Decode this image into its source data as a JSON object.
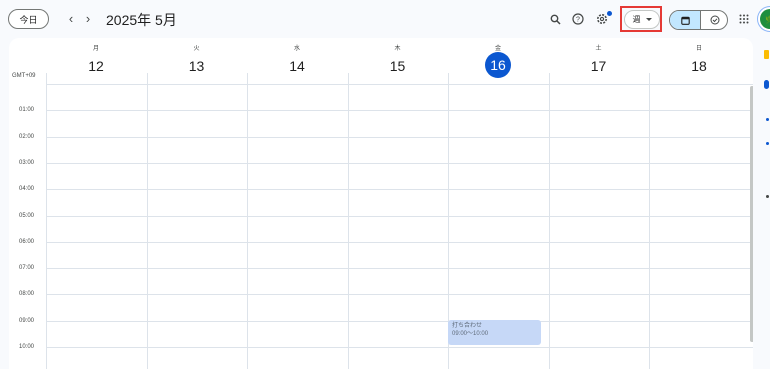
{
  "header": {
    "today_label": "今日",
    "prev_icon": "chevron-left-icon",
    "next_icon": "chevron-right-icon",
    "title": "2025年 5月",
    "view_select": "週",
    "avatar_text": "🌿"
  },
  "calendar": {
    "timezone": "GMT+09",
    "days": [
      {
        "dow": "月",
        "date": "12"
      },
      {
        "dow": "火",
        "date": "13"
      },
      {
        "dow": "水",
        "date": "14"
      },
      {
        "dow": "木",
        "date": "15"
      },
      {
        "dow": "金",
        "date": "16"
      },
      {
        "dow": "土",
        "date": "17"
      },
      {
        "dow": "日",
        "date": "18"
      }
    ],
    "today_index": 4,
    "hours": [
      "01:00",
      "02:00",
      "03:00",
      "04:00",
      "05:00",
      "06:00",
      "07:00",
      "08:00",
      "09:00",
      "10:00"
    ],
    "event": {
      "title": "打ち合わせ",
      "time": "09:00～10:00"
    }
  },
  "colors": {
    "accent": "#0b57d0",
    "event_bg": "#c6d8f7",
    "highlight": "#e53935"
  }
}
